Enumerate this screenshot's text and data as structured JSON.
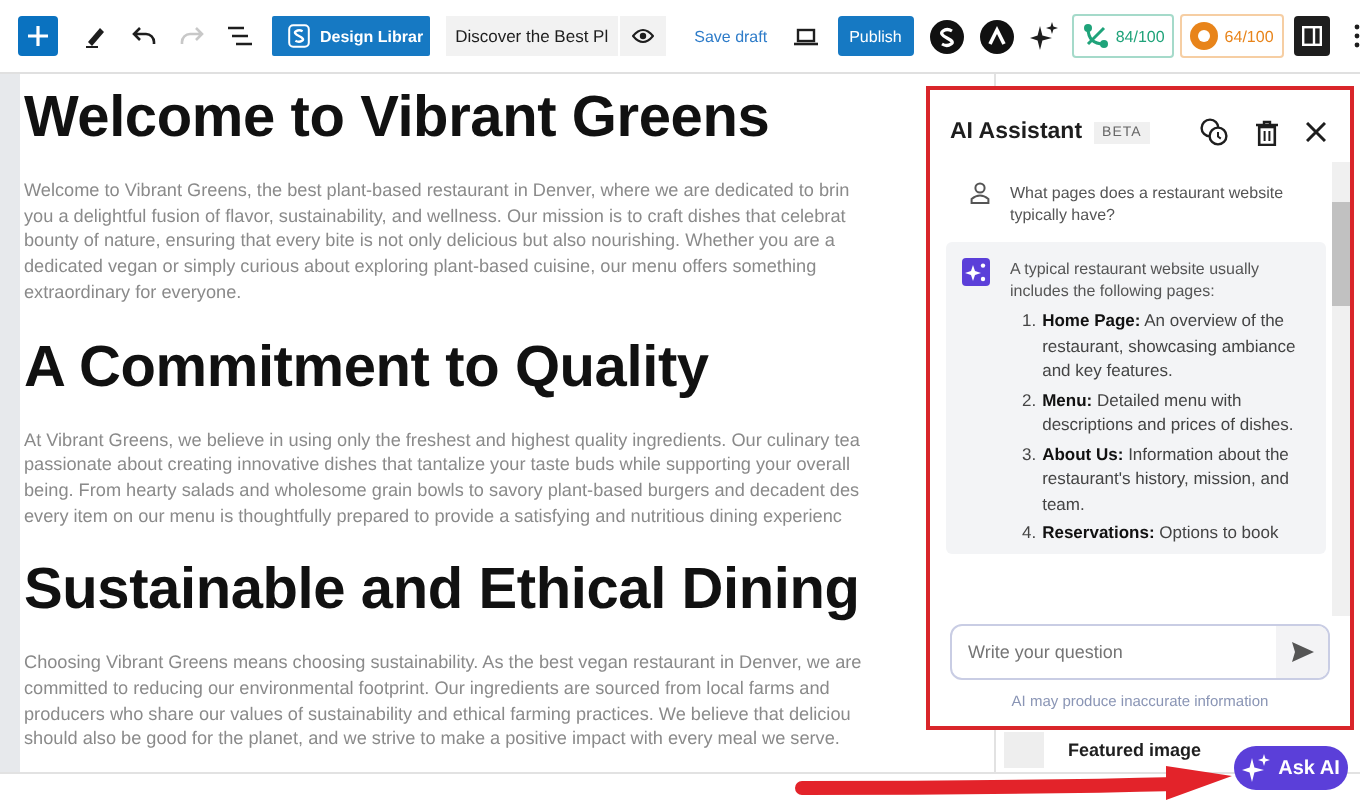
{
  "toolbar": {
    "design_library": "Design Librar",
    "title_field": "Discover the Best Pl",
    "save_draft": "Save draft",
    "publish": "Publish",
    "scores": [
      {
        "value": "84/100",
        "color": "#1fa37a"
      },
      {
        "value": "64/100",
        "color": "#e8841a"
      }
    ]
  },
  "content": {
    "sections": [
      {
        "heading": "Welcome to Vibrant Greens",
        "lines": [
          "Welcome to Vibrant Greens, the best plant-based restaurant in Denver, where we are dedicated to brin",
          "you a delightful fusion of flavor, sustainability, and wellness. Our mission is to craft dishes that celebrat",
          "bounty of nature, ensuring that every bite is not only delicious but also nourishing. Whether you are a",
          "dedicated vegan or simply curious about exploring plant-based cuisine, our menu offers something",
          "extraordinary for everyone."
        ]
      },
      {
        "heading": "A Commitment to Quality",
        "lines": [
          "At Vibrant Greens, we believe in using only the freshest and highest quality ingredients. Our culinary tea",
          "passionate about creating innovative dishes that tantalize your taste buds while supporting your overall",
          "being. From hearty salads and wholesome grain bowls to savory plant-based burgers and decadent des",
          "every item on our menu is thoughtfully prepared to provide a satisfying and nutritious dining experienc"
        ]
      },
      {
        "heading": "Sustainable and Ethical Dining",
        "lines": [
          "Choosing Vibrant Greens means choosing sustainability. As the best vegan restaurant in Denver, we are",
          "committed to reducing our environmental footprint. Our ingredients are sourced from local farms and",
          "producers who share our values of sustainability and ethical farming practices. We believe that deliciou",
          "should also be good for the planet, and we strive to make a positive impact with every meal we serve."
        ]
      }
    ]
  },
  "sidebar": {
    "featured_image": "Featured image"
  },
  "ai_panel": {
    "title": "AI Assistant",
    "badge": "BETA",
    "messages": [
      {
        "kind": "user",
        "text": "What pages does a restaurant website typically have?"
      },
      {
        "kind": "assistant",
        "text": "A typical restaurant website usually includes the following pages:",
        "items": [
          {
            "number": "1.",
            "text": "**Home Page:** An overview of the restaurant, showcasing ambiance and key features."
          },
          {
            "number": "2.",
            "text": "**Menu:** Detailed menu with descriptions and prices of dishes."
          },
          {
            "number": "3.",
            "text": "**About Us:** Information about the restaurant's history, mission, and team."
          },
          {
            "number": "4.",
            "text": "**Reservations:** Options to book"
          }
        ]
      }
    ],
    "input": {
      "placeholder": "Write your question"
    },
    "disclaimer": "AI may produce inaccurate information"
  },
  "ask_ai": "Ask AI"
}
